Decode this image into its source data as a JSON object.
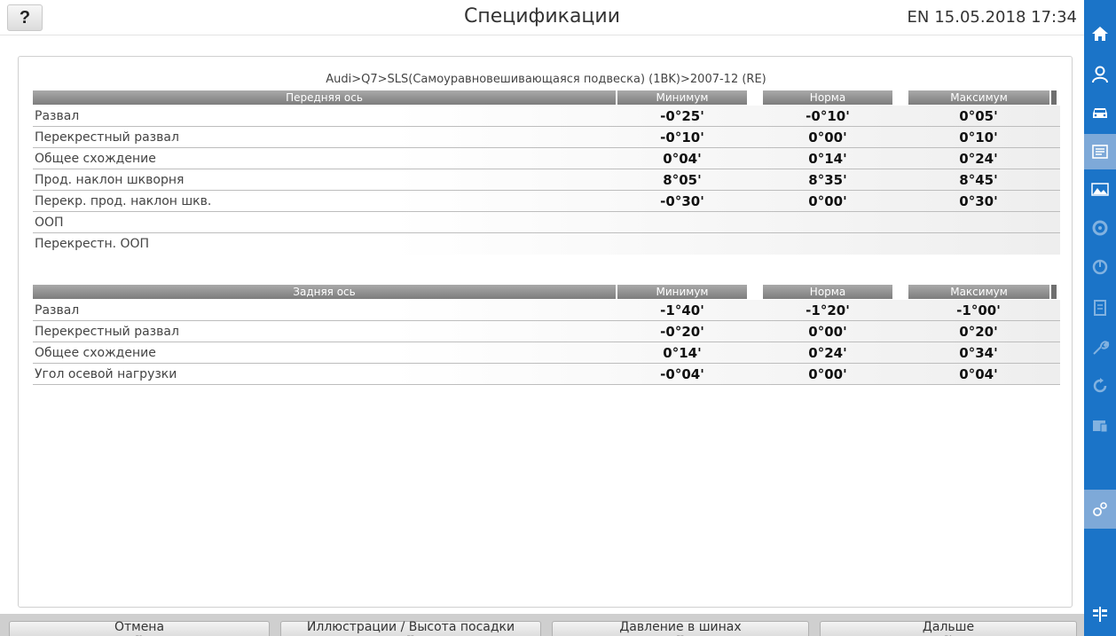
{
  "header": {
    "help_label": "?",
    "title": "Спецификации",
    "lang": "EN",
    "datetime": "15.05.2018 17:34"
  },
  "breadcrumb": "Audi>Q7>SLS(Самоуравновешивающаяся подвеска) (1BK)>2007-12 (RE)",
  "front_axle": {
    "header": "Передняя ось",
    "columns": [
      "Минимум",
      "Норма",
      "Максимум"
    ],
    "rows": [
      {
        "name": "Развал",
        "min": "-0°25'",
        "norm": "-0°10'",
        "max": "0°05'"
      },
      {
        "name": "Перекрестный развал",
        "min": "-0°10'",
        "norm": "0°00'",
        "max": "0°10'"
      },
      {
        "name": "Общее схождение",
        "min": "0°04'",
        "norm": "0°14'",
        "max": "0°24'"
      },
      {
        "name": "Прод. наклон шкворня",
        "min": "8°05'",
        "norm": "8°35'",
        "max": "8°45'"
      },
      {
        "name": "Перекр. прод. наклон шкв.",
        "min": "-0°30'",
        "norm": "0°00'",
        "max": "0°30'"
      },
      {
        "name": "ООП",
        "min": "",
        "norm": "",
        "max": ""
      },
      {
        "name": "Перекрестн. ООП",
        "min": "",
        "norm": "",
        "max": ""
      }
    ]
  },
  "rear_axle": {
    "header": "Задняя ось",
    "columns": [
      "Минимум",
      "Норма",
      "Максимум"
    ],
    "rows": [
      {
        "name": "Развал",
        "min": "-1°40'",
        "norm": "-1°20'",
        "max": "-1°00'"
      },
      {
        "name": "Перекрестный развал",
        "min": "-0°20'",
        "norm": "0°00'",
        "max": "0°20'"
      },
      {
        "name": "Общее схождение",
        "min": "0°14'",
        "norm": "0°24'",
        "max": "0°34'"
      },
      {
        "name": "Угол осевой нагрузки",
        "min": "-0°04'",
        "norm": "0°00'",
        "max": "0°04'"
      }
    ]
  },
  "footer": {
    "buttons": [
      {
        "label": "Отмена",
        "key": "F1"
      },
      {
        "label": "Иллюстрации / Высота посадки",
        "key": "F2"
      },
      {
        "label": "Давление в шинах",
        "key": "F3"
      },
      {
        "label": "Дальше",
        "key": "F4"
      }
    ]
  },
  "sidebar": {
    "icons": [
      "home-icon",
      "customer-icon",
      "car-icon",
      "specifications-icon",
      "images-icon",
      "wheel-icon",
      "measure-icon",
      "report-icon",
      "adjust-icon",
      "rotate-icon",
      "database-icon",
      "settings-icon",
      "lift-icon"
    ],
    "active": "specifications-icon"
  },
  "colors": {
    "sidebar": "#1b74c8",
    "sidebar_active": "#7ea9d8",
    "table_header": "#8c8c8c"
  }
}
